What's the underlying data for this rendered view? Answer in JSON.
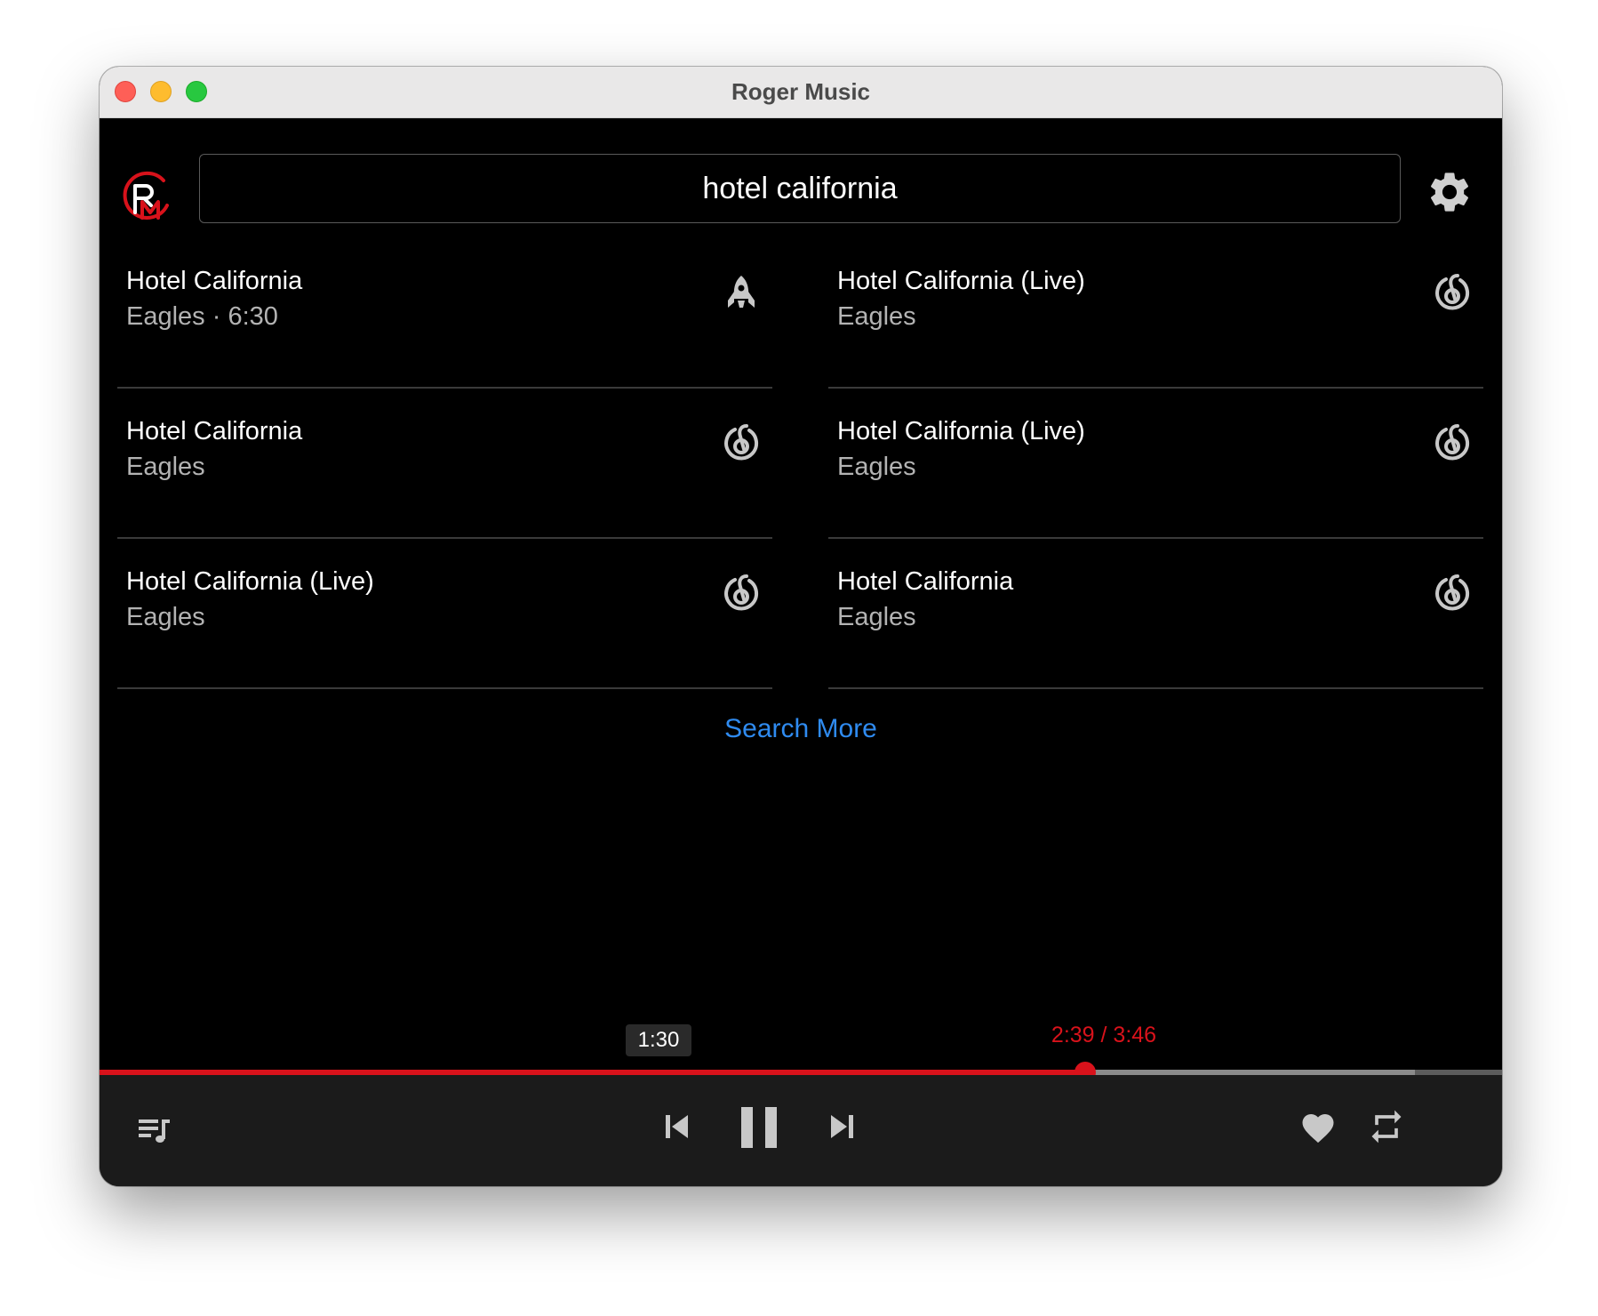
{
  "window": {
    "title": "Roger Music"
  },
  "search": {
    "value": "hotel california",
    "more_label": "Search More"
  },
  "results": [
    {
      "title": "Hotel California",
      "subtitle": "Eagles · 6:30",
      "source_icon": "rocket-icon"
    },
    {
      "title": "Hotel California (Live)",
      "subtitle": "Eagles",
      "source_icon": "netease-music-icon"
    },
    {
      "title": "Hotel California",
      "subtitle": "Eagles",
      "source_icon": "netease-music-icon"
    },
    {
      "title": "Hotel California (Live)",
      "subtitle": "Eagles",
      "source_icon": "netease-music-icon"
    },
    {
      "title": "Hotel California (Live)",
      "subtitle": "Eagles",
      "source_icon": "netease-music-icon"
    },
    {
      "title": "Hotel California",
      "subtitle": "Eagles",
      "source_icon": "netease-music-icon"
    }
  ],
  "player": {
    "hover_time": "1:30",
    "time_readout": "2:39 / 3:46",
    "progress_fraction": 0.703,
    "buffered_fraction": 0.938,
    "accent_color": "#d8121b",
    "link_color": "#2f8bf0",
    "icons": [
      "playlist-icon",
      "previous-icon",
      "pause-icon",
      "next-icon",
      "heart-icon",
      "repeat-icon"
    ]
  }
}
